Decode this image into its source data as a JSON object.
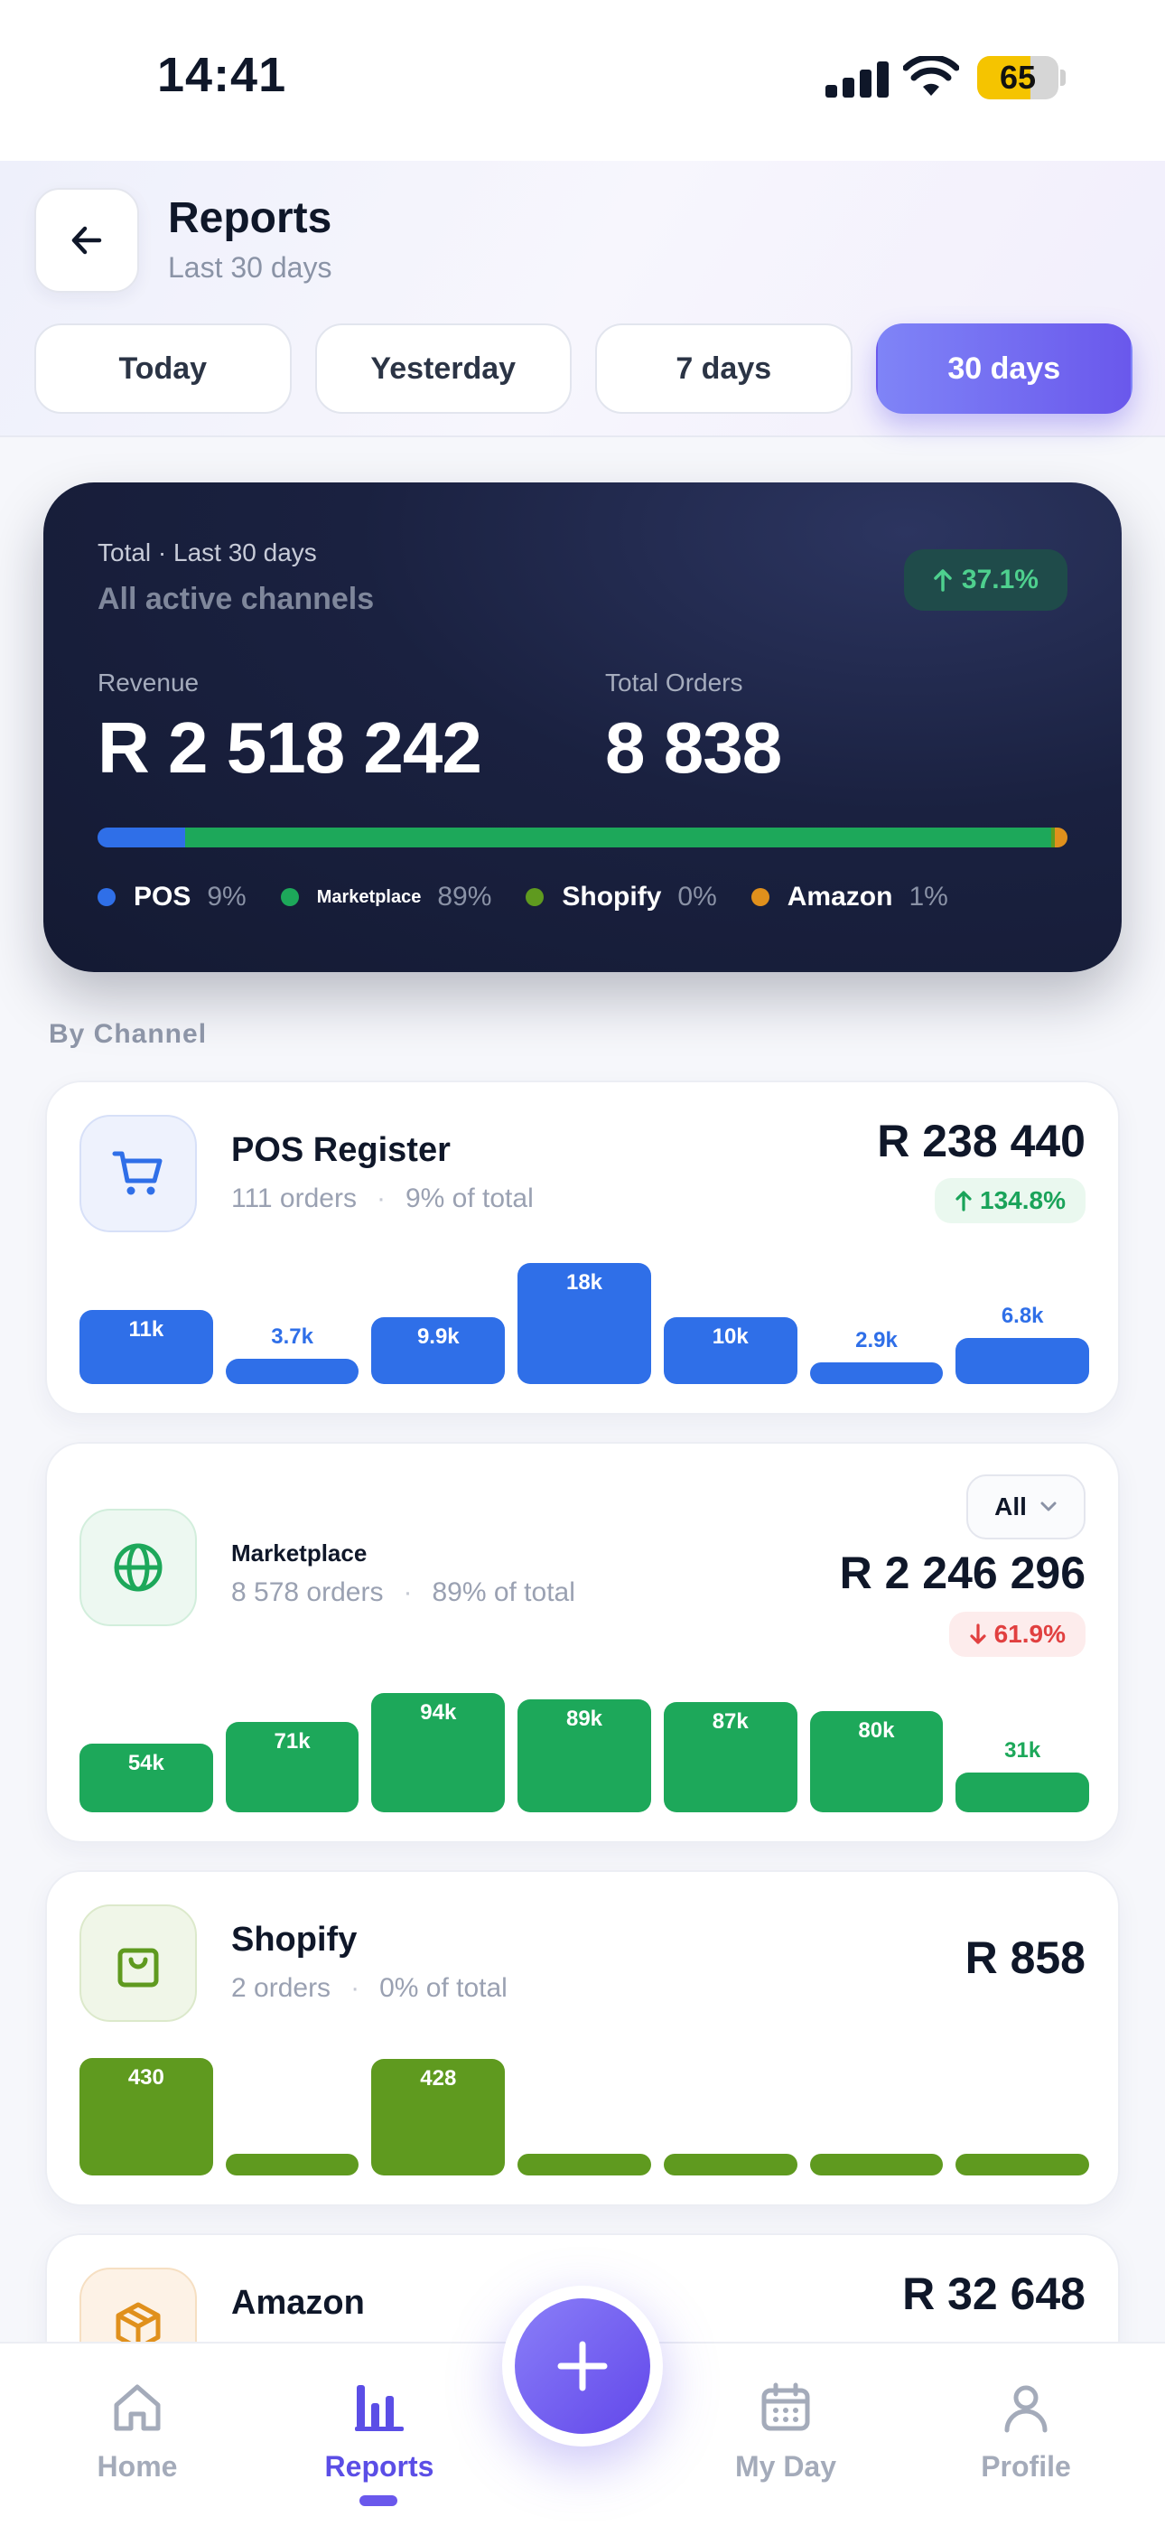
{
  "status": {
    "time": "14:41",
    "battery": "65",
    "battery_level": 0.65
  },
  "header": {
    "title": "Reports",
    "subtitle": "Last 30 days"
  },
  "tabs": [
    {
      "label": "Today",
      "active": false
    },
    {
      "label": "Yesterday",
      "active": false
    },
    {
      "label": "7 days",
      "active": false
    },
    {
      "label": "30 days",
      "active": true
    }
  ],
  "summary": {
    "label": "Total · Last 30 days",
    "sub": "All active channels",
    "badge": "37.1%",
    "revenue_label": "Revenue",
    "revenue": "R 2 518 242",
    "orders_label": "Total Orders",
    "orders": "8 838",
    "shares": [
      {
        "name": "POS",
        "pct": "9%",
        "value": 9,
        "color": "#2f6fe8"
      },
      {
        "name": "Marketplace",
        "pct": "89%",
        "value": 89,
        "color": "#1da85a"
      },
      {
        "name": "Shopify",
        "pct": "0%",
        "value": 0.4,
        "color": "#5f9a1f"
      },
      {
        "name": "Amazon",
        "pct": "1%",
        "value": 1.3,
        "color": "#e0901c"
      }
    ]
  },
  "section_label": "By Channel",
  "channels": [
    {
      "name": "POS Register",
      "orders": "111 orders",
      "share": "9% of total",
      "revenue": "R 238 440",
      "badge": "134.8%",
      "trend": "up",
      "color": "#2f6fe8",
      "bars": [
        {
          "label": "11k",
          "value": 11
        },
        {
          "label": "3.7k",
          "value": 3.7
        },
        {
          "label": "9.9k",
          "value": 9.9
        },
        {
          "label": "18k",
          "value": 18
        },
        {
          "label": "10k",
          "value": 10
        },
        {
          "label": "2.9k",
          "value": 2.9
        },
        {
          "label": "6.8k",
          "value": 6.8
        }
      ]
    },
    {
      "name": "Marketplace",
      "orders": "8 578 orders",
      "share": "89% of total",
      "revenue": "R 2 246 296",
      "badge": "61.9%",
      "trend": "down",
      "color": "#1da85a",
      "filter": "All",
      "bars": [
        {
          "label": "54k",
          "value": 54
        },
        {
          "label": "71k",
          "value": 71
        },
        {
          "label": "94k",
          "value": 94
        },
        {
          "label": "89k",
          "value": 89
        },
        {
          "label": "87k",
          "value": 87
        },
        {
          "label": "80k",
          "value": 80
        },
        {
          "label": "31k",
          "value": 31
        }
      ]
    },
    {
      "name": "Shopify",
      "orders": "2 orders",
      "share": "0% of total",
      "revenue": "R 858",
      "color": "#5f9a1f",
      "bars": [
        {
          "label": "430",
          "value": 430
        },
        {
          "label": "",
          "value": 0
        },
        {
          "label": "428",
          "value": 428
        },
        {
          "label": "",
          "value": 0
        },
        {
          "label": "",
          "value": 0
        },
        {
          "label": "",
          "value": 0
        },
        {
          "label": "",
          "value": 0
        }
      ]
    },
    {
      "name": "Amazon",
      "revenue": "R 32 648",
      "color": "#e0901c"
    }
  ],
  "nav": [
    {
      "label": "Home",
      "icon": "home-icon",
      "active": false
    },
    {
      "label": "Reports",
      "icon": "bar-chart-icon",
      "active": true
    },
    {
      "label": "My Day",
      "icon": "calendar-icon",
      "active": false
    },
    {
      "label": "Profile",
      "icon": "user-icon",
      "active": false
    }
  ]
}
